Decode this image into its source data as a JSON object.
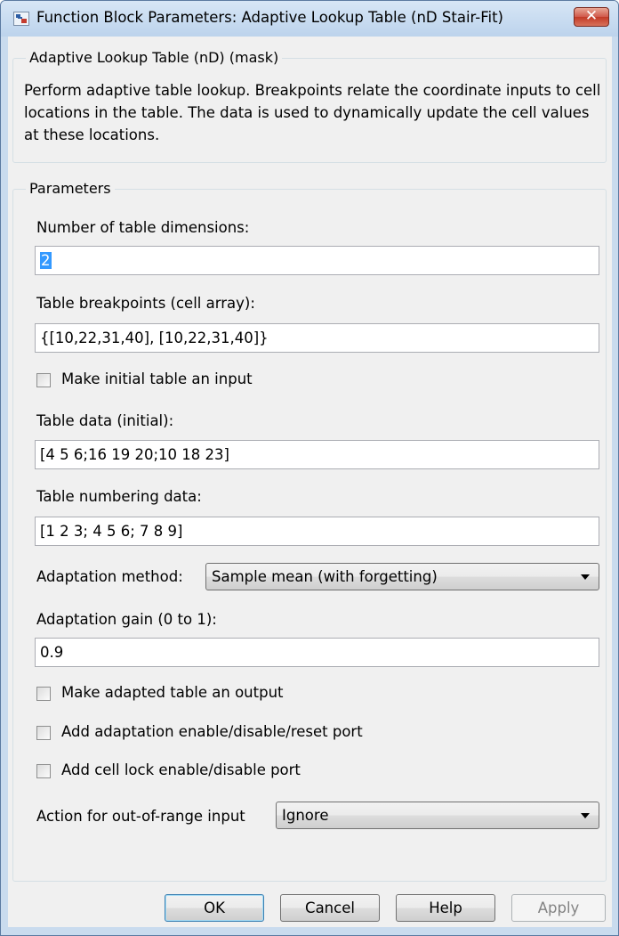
{
  "window": {
    "title": "Function Block Parameters: Adaptive Lookup Table (nD Stair-Fit)",
    "close_label": "✕"
  },
  "mask_group": {
    "legend": "Adaptive Lookup Table (nD) (mask)",
    "description": "Perform adaptive table lookup.  Breakpoints relate the coordinate inputs to cell locations in the table.  The data is used to dynamically update the cell values at these locations."
  },
  "params_group": {
    "legend": "Parameters",
    "num_dims": {
      "label": "Number of table dimensions:",
      "value": "2"
    },
    "breakpoints": {
      "label": "Table breakpoints (cell array):",
      "value": "{[10,22,31,40], [10,22,31,40]}"
    },
    "initial_table_input": {
      "label": "Make initial table an input",
      "checked": false
    },
    "table_data": {
      "label": "Table data (initial):",
      "value": "[4 5 6;16 19 20;10 18 23]"
    },
    "numbering_data": {
      "label": "Table numbering data:",
      "value": "[1 2 3; 4 5 6; 7 8 9]"
    },
    "adaptation_method": {
      "label": "Adaptation method:",
      "selected": "Sample mean (with forgetting)"
    },
    "adaptation_gain": {
      "label": "Adaptation gain (0 to 1):",
      "value": "0.9"
    },
    "adapted_output": {
      "label": "Make adapted table an output",
      "checked": false
    },
    "reset_port": {
      "label": "Add adaptation enable/disable/reset port",
      "checked": false
    },
    "cell_lock_port": {
      "label": "Add cell lock enable/disable port",
      "checked": false
    },
    "out_of_range": {
      "label": "Action for out-of-range input",
      "selected": "Ignore"
    }
  },
  "buttons": {
    "ok": "OK",
    "cancel": "Cancel",
    "help": "Help",
    "apply": "Apply"
  }
}
